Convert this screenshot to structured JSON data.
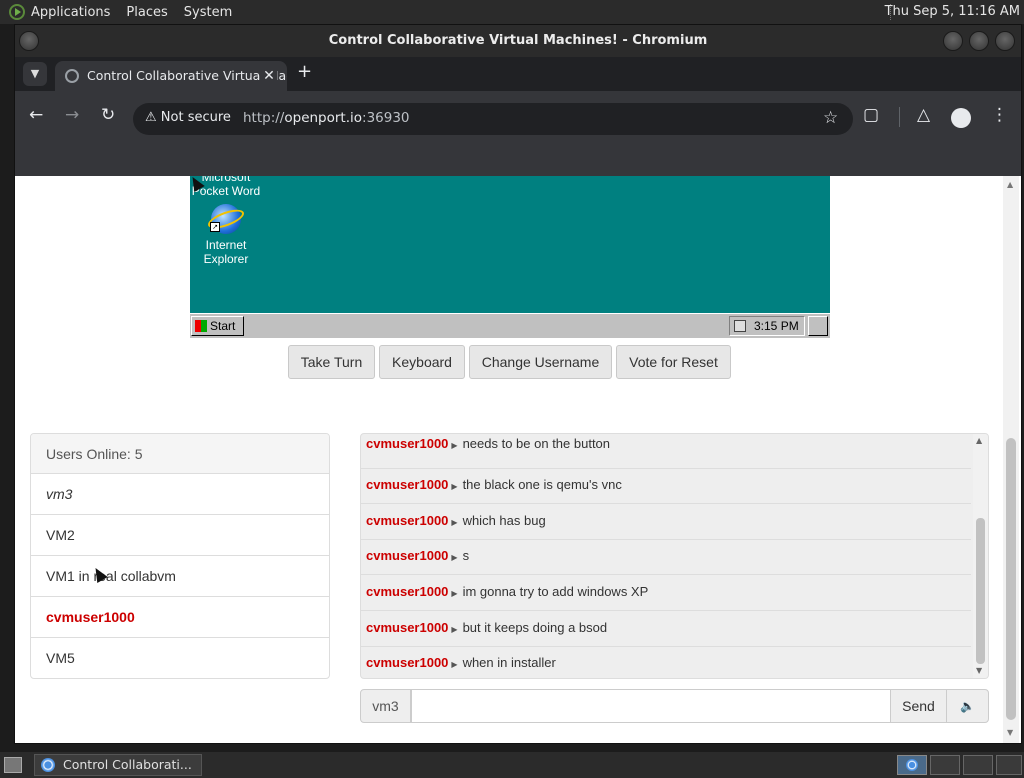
{
  "top_panel": {
    "menus": [
      "Applications",
      "Places",
      "System"
    ],
    "clock": "Thu Sep  5, 11:16 AM"
  },
  "window": {
    "title": "Control Collaborative Virtual Machines! - Chromium"
  },
  "browser": {
    "tab_title": "Control Collaborative Virtual Machines!",
    "security_label": "Not secure",
    "url_scheme": "http://",
    "url_host": "openport.io",
    "url_port": ":36930"
  },
  "vm": {
    "desktop_icons": [
      "Microsoft Pocket Word",
      "Internet Explorer"
    ],
    "icon_label_word_line1": "Microsoft",
    "icon_label_word_line2": "Pocket Word",
    "icon_label_ie_line1": "Internet",
    "icon_label_ie_line2": "Explorer",
    "start_label": "Start",
    "tray_time": "3:15 PM"
  },
  "vm_controls": {
    "take_turn": "Take Turn",
    "keyboard": "Keyboard",
    "change_username": "Change Username",
    "vote_reset": "Vote for Reset"
  },
  "users": {
    "header": "Users Online: 5",
    "list": [
      {
        "name": "vm3"
      },
      {
        "name": "VM2"
      },
      {
        "name": "VM1 in real collabvm"
      },
      {
        "name": "cvmuser1000"
      },
      {
        "name": "VM5"
      }
    ]
  },
  "chat": {
    "messages": [
      {
        "user": "cvmuser1000",
        "text": "needs to be on the button"
      },
      {
        "user": "cvmuser1000",
        "text": "the black one is qemu's vnc"
      },
      {
        "user": "cvmuser1000",
        "text": "which has bug"
      },
      {
        "user": "cvmuser1000",
        "text": "s"
      },
      {
        "user": "cvmuser1000",
        "text": "im gonna try to add windows XP"
      },
      {
        "user": "cvmuser1000",
        "text": "but it keeps doing a bsod"
      },
      {
        "user": "cvmuser1000",
        "text": "when in installer"
      }
    ],
    "username": "vm3",
    "input_value": "",
    "send_label": "Send"
  },
  "taskbar": {
    "task_label": "Control Collaborati..."
  },
  "colors": {
    "vm_desktop": "#008080",
    "chat_username": "#cc0000",
    "browser_toolbar": "#35363a"
  },
  "icons": [
    "back-icon",
    "forward-icon",
    "reload-icon",
    "warning-icon",
    "star-icon",
    "extensions-icon",
    "labs-icon",
    "profile-icon",
    "menu-icon",
    "speaker-icon"
  ]
}
